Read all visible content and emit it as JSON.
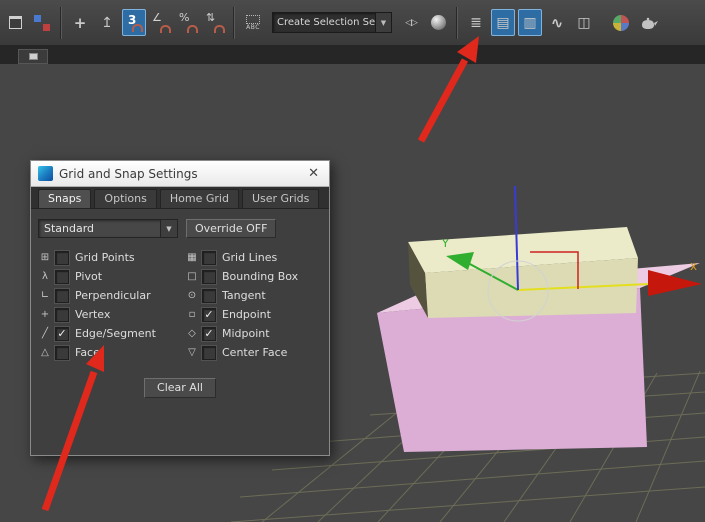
{
  "icons": {
    "chevron_down": "▼",
    "close": "✕",
    "check": "✓"
  },
  "toolbar": {
    "move_glyph": "+",
    "select_place_glyph": "↥",
    "snap_toggle_value": "3",
    "angle_snap_glyph": "∠",
    "percent_snap_glyph": "%",
    "spinner_snap_glyph": "⇅",
    "named_sets_label": "ABC",
    "selection_set_value": "Create Selection Se",
    "mirror_glyph": "◁▷",
    "layers_glyph": "≣",
    "explorer_glyph": "▤",
    "ribbon_glyph": "▥",
    "curve_editor_glyph": "∿",
    "schematic_glyph": "◫"
  },
  "dialog": {
    "title": "Grid and Snap Settings",
    "tabs": [
      {
        "label": "Snaps",
        "active": true
      },
      {
        "label": "Options",
        "active": false
      },
      {
        "label": "Home Grid",
        "active": false
      },
      {
        "label": "User Grids",
        "active": false
      }
    ],
    "snap_type": "Standard",
    "override_button": "Override OFF",
    "clear_all_button": "Clear All",
    "snaps_left": [
      {
        "label": "Grid Points",
        "checked": false,
        "icon": "⊞"
      },
      {
        "label": "Pivot",
        "checked": false,
        "icon": "λ"
      },
      {
        "label": "Perpendicular",
        "checked": false,
        "icon": "∟"
      },
      {
        "label": "Vertex",
        "checked": false,
        "icon": "+"
      },
      {
        "label": "Edge/Segment",
        "checked": true,
        "icon": "╱"
      },
      {
        "label": "Face",
        "checked": false,
        "icon": "△"
      }
    ],
    "snaps_right": [
      {
        "label": "Grid Lines",
        "checked": false,
        "icon": "▦"
      },
      {
        "label": "Bounding Box",
        "checked": false,
        "icon": "□"
      },
      {
        "label": "Tangent",
        "checked": false,
        "icon": "⊙"
      },
      {
        "label": "Endpoint",
        "checked": true,
        "icon": "▫"
      },
      {
        "label": "Midpoint",
        "checked": true,
        "icon": "◇"
      },
      {
        "label": "Center Face",
        "checked": false,
        "icon": "▽"
      }
    ]
  },
  "viewport": {
    "x_axis_label": "x",
    "y_axis_label": "Y"
  },
  "colors": {
    "pink_top": "#eccbe3",
    "pink_front": "#dcaed6",
    "cream_top": "#ecebc9",
    "cream_front": "#dcdbb4",
    "cream_side": "#55533d",
    "grid": "#73735a",
    "axis_x": "#e3df1f",
    "axis_y": "#2fae2f",
    "axis_z": "#3a3ad8",
    "cone_red": "#c6170c",
    "annotation_red": "#e0281c"
  }
}
